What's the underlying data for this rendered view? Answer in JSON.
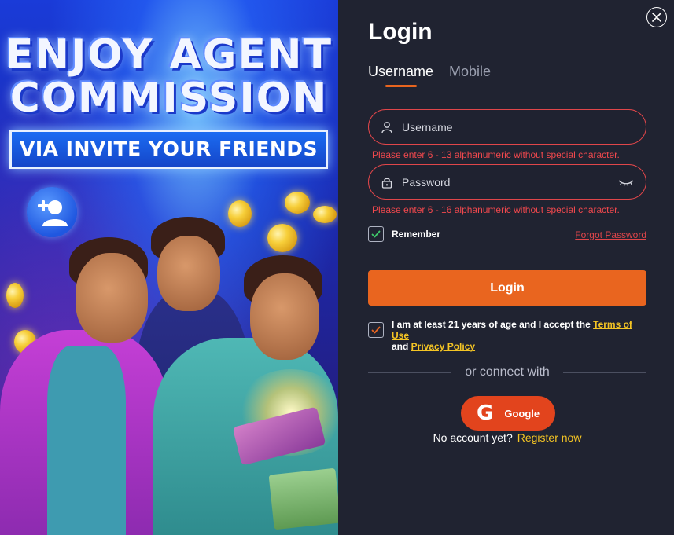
{
  "promo": {
    "headline_line1": "ENJOY AGENT",
    "headline_line2": "COMMISSION",
    "banner_text": "VIA INVITE YOUR FRIENDS"
  },
  "login": {
    "title": "Login",
    "tabs": [
      {
        "label": "Username",
        "active": true
      },
      {
        "label": "Mobile",
        "active": false
      }
    ],
    "username": {
      "placeholder": "Username",
      "value": "",
      "error": "Please enter 6 - 13 alphanumeric without special character."
    },
    "password": {
      "placeholder": "Password",
      "value": "",
      "error": "Please enter 6 - 16 alphanumeric without special character."
    },
    "remember": {
      "label": "Remember",
      "checked": true
    },
    "forgot_password": "Forgot Password",
    "submit_label": "Login",
    "terms": {
      "checked": true,
      "text_before": "I am at least 21 years of age and I accept the ",
      "terms_link": "Terms of Use",
      "text_mid": " and ",
      "privacy_link": "Privacy Policy"
    },
    "divider_text": "or connect with",
    "google_label": "Google",
    "no_account": "No account yet?",
    "register_link": "Register now"
  },
  "colors": {
    "panel_bg": "#202331",
    "accent_orange": "#e9651f",
    "error_red": "#e0464a",
    "link_yellow": "#f5c524",
    "google_red": "#e2441d"
  },
  "icons": [
    "close-icon",
    "user-icon",
    "lock-icon",
    "eye-closed-icon",
    "check-icon",
    "google-icon",
    "add-user-icon"
  ]
}
